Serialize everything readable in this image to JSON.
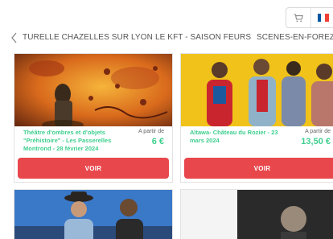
{
  "header": {
    "cart_icon": "cart-icon",
    "language_flag_icon": "french-flag-icon",
    "flag_colors": [
      "#0055a4",
      "#ffffff",
      "#ef4135"
    ]
  },
  "categories": {
    "prev_icon": "chevron-left-icon",
    "items": [
      {
        "label": "TURELLE CHAZELLES SUR LYON"
      },
      {
        "label": "LE KFT - SAISON FEURS"
      },
      {
        "label": "SCENES-EN-FOREZ"
      }
    ]
  },
  "events": [
    {
      "title": "Théâtre d'ombres et d'objets \"Préhistoire\" - Les Passerelles Montrond - 28 février 2024",
      "price_label": "A partir de",
      "price": "6 €",
      "button_label": "VOIR"
    },
    {
      "title": "Aïtawa- Château du Rozier - 23 mars 2024",
      "price_label": "A partir de",
      "price": "13,50 €",
      "button_label": "VOIR"
    }
  ],
  "colors": {
    "accent_green": "#3ecf8e",
    "button_red": "#e8474c"
  }
}
